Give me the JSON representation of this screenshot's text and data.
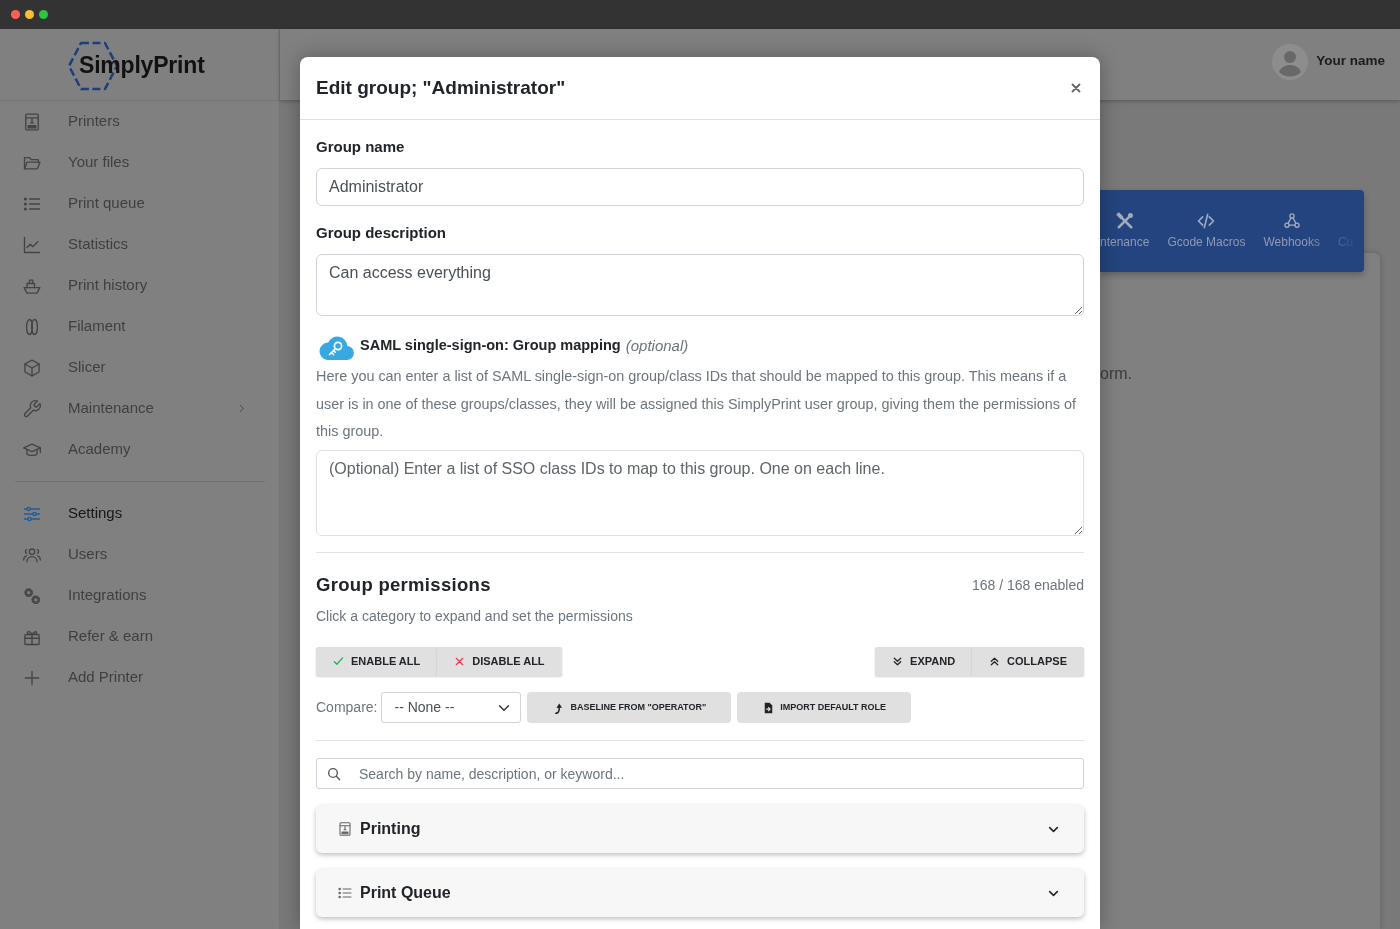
{
  "window": {
    "controls": [
      {
        "color": "#ff5f57"
      },
      {
        "color": "#febc2e"
      },
      {
        "color": "#28c840"
      }
    ]
  },
  "sidebar": {
    "logo": "SimplyPrint",
    "sections": [
      {
        "items": [
          {
            "label": "Printers",
            "kind": "link",
            "selected": false
          },
          {
            "label": "Your files",
            "kind": "link",
            "selected": false
          },
          {
            "label": "Print queue",
            "kind": "link",
            "selected": false
          },
          {
            "label": "Statistics",
            "kind": "link",
            "selected": false
          },
          {
            "label": "Print history",
            "kind": "link",
            "selected": false
          },
          {
            "label": "Filament",
            "kind": "link",
            "selected": false
          },
          {
            "label": "Slicer",
            "kind": "link",
            "selected": false
          },
          {
            "label": "Maintenance",
            "kind": "submenu",
            "selected": false
          },
          {
            "label": "Academy",
            "kind": "link",
            "selected": false
          }
        ]
      },
      {
        "items": [
          {
            "label": "Settings",
            "kind": "link",
            "selected": true
          },
          {
            "label": "Users",
            "kind": "link",
            "selected": false
          },
          {
            "label": "Integrations",
            "kind": "link",
            "selected": false
          },
          {
            "label": "Refer & earn",
            "kind": "link",
            "selected": false
          },
          {
            "label": "Add Printer",
            "kind": "link",
            "selected": false
          }
        ]
      }
    ]
  },
  "header": {
    "user_name": "Your name"
  },
  "settings_tabs": [
    {
      "label": "ntenance"
    },
    {
      "label": "Gcode Macros"
    },
    {
      "label": "Webhooks"
    },
    {
      "label": "Cu"
    }
  ],
  "content_card": {
    "text": "orm."
  },
  "dialog": {
    "title": "Edit group; \"Administrator\"",
    "group_name": {
      "label": "Group name",
      "value": "Administrator"
    },
    "group_description": {
      "label": "Group description",
      "value": "Can access everything"
    },
    "saml": {
      "title": "SAML single-sign-on: Group mapping",
      "note": "(optional)",
      "description": "Here you can enter a list of SAML single-sign-on group/class IDs that should be mapped to this group. This means if a user is in one of these groups/classes, they will be assigned this SimplyPrint user group, giving them the permissions of this group.",
      "placeholder": "(Optional) Enter a list of SSO class IDs to map to this group. One on each line."
    },
    "permissions": {
      "title": "Group permissions",
      "count": "168 / 168 enabled",
      "hint": "Click a category to expand and set the permissions",
      "bulk_actions": [
        {
          "label": "ENABLE ALL"
        },
        {
          "label": "DISABLE ALL"
        }
      ],
      "view_actions": [
        {
          "label": "EXPAND"
        },
        {
          "label": "COLLAPSE"
        }
      ],
      "compare": {
        "label": "Compare:",
        "value": "-- None --"
      },
      "tools": [
        {
          "label": "BASELINE FROM \"OPERATOR\""
        },
        {
          "label": "IMPORT DEFAULT ROLE"
        }
      ],
      "search": {
        "placeholder": "Search by name, description, or keyword..."
      },
      "categories": [
        {
          "label": "Printing",
          "expanded": false
        },
        {
          "label": "Print Queue",
          "expanded": false
        }
      ]
    }
  }
}
